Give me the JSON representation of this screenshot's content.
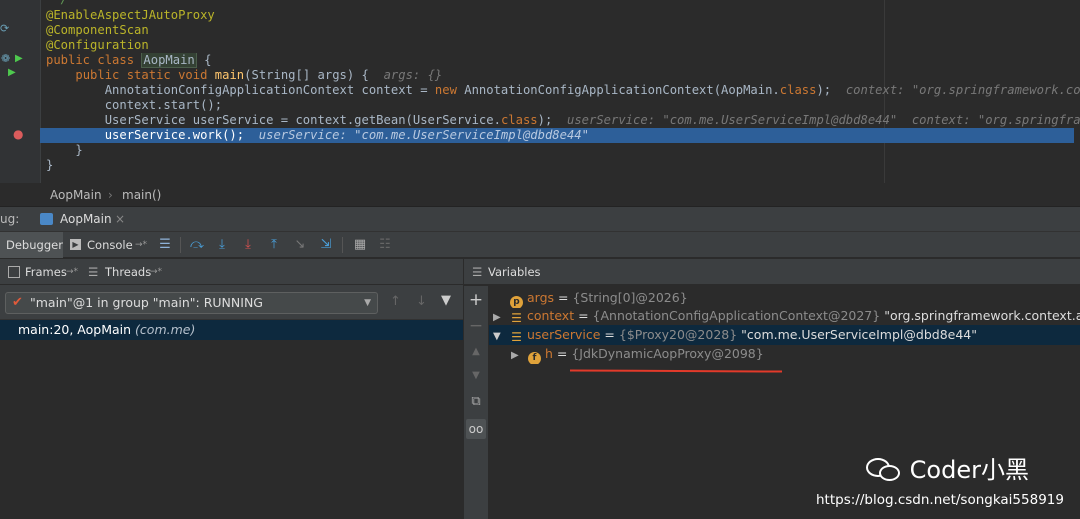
{
  "editor": {
    "lines": [
      {
        "parts": [
          {
            "c": "cm",
            "t": " */"
          }
        ]
      },
      {
        "parts": [
          {
            "c": "ann",
            "t": "@EnableAspectJAutoProxy"
          }
        ]
      },
      {
        "parts": [
          {
            "c": "ann",
            "t": "@ComponentScan"
          }
        ]
      },
      {
        "parts": [
          {
            "c": "ann",
            "t": "@Configuration"
          }
        ]
      },
      {
        "parts": [
          {
            "c": "kw",
            "t": "public class "
          },
          {
            "c": "cls-hl",
            "t": "AopMain"
          },
          {
            "c": "",
            "t": " {"
          }
        ]
      },
      {
        "parts": [
          {
            "c": "",
            "t": "    "
          },
          {
            "c": "kw",
            "t": "public static void "
          },
          {
            "c": "fn",
            "t": "main"
          },
          {
            "c": "",
            "t": "(String[] args) {  "
          },
          {
            "c": "hint",
            "t": "args: {}"
          }
        ]
      },
      {
        "parts": [
          {
            "c": "",
            "t": "        AnnotationConfigApplicationContext context = "
          },
          {
            "c": "kw",
            "t": "new "
          },
          {
            "c": "",
            "t": "AnnotationConfigApplicationContext(AopMain."
          },
          {
            "c": "kw",
            "t": "class"
          },
          {
            "c": "",
            "t": ");  "
          },
          {
            "c": "hint",
            "t": "context: \"org.springframework.context.a"
          }
        ]
      },
      {
        "parts": [
          {
            "c": "",
            "t": "        context.start();"
          }
        ]
      },
      {
        "parts": [
          {
            "c": "",
            "t": "        UserService userService = context.getBean(UserService."
          },
          {
            "c": "kw",
            "t": "class"
          },
          {
            "c": "",
            "t": ");  "
          },
          {
            "c": "hint",
            "t": "userService: \"com.me.UserServiceImpl@dbd8e44\"  context: \"org.springframework."
          }
        ]
      },
      {
        "parts": [
          {
            "c": "",
            "t": "        userService.work();  "
          },
          {
            "c": "hint",
            "t": "userService: \"com.me.UserServiceImpl@dbd8e44\""
          }
        ]
      },
      {
        "parts": [
          {
            "c": "",
            "t": "    }"
          }
        ]
      },
      {
        "parts": [
          {
            "c": "",
            "t": "}"
          }
        ]
      }
    ]
  },
  "breadcrumb": {
    "items": [
      "AopMain",
      "›",
      "main()"
    ]
  },
  "debug_tabs": {
    "label": "ug:",
    "session": "AopMain",
    "close": "×"
  },
  "toolbar": {
    "debugger_tab": "Debugger",
    "console_tab": "Console",
    "console_suffix": "→*"
  },
  "frames": {
    "header_frames": "Frames",
    "header_frames_suffix": "→*",
    "header_threads": "Threads",
    "header_threads_suffix": "→*",
    "thread_selected": "\"main\"@1 in group \"main\": RUNNING",
    "frame_method": "main:20, AopMain",
    "frame_pkg": "(com.me)"
  },
  "variables": {
    "header": "Variables",
    "rows": [
      {
        "name": "args",
        "eq": " = ",
        "type": "{String[0]@2026}",
        "value": ""
      },
      {
        "name": "context",
        "eq": " = ",
        "type": "{AnnotationConfigApplicationContext@2027}",
        "value": " \"org.springframework.context.an"
      },
      {
        "name": "userService",
        "eq": " = ",
        "type": "{$Proxy20@2028}",
        "value": " \"com.me.UserServiceImpl@dbd8e44\""
      },
      {
        "name": "h",
        "eq": " = ",
        "type": "{JdkDynamicAopProxy@2098}",
        "value": ""
      }
    ]
  },
  "watermark": {
    "brand": "Coder小黑",
    "url": "https://blog.csdn.net/songkai558919"
  },
  "colors": {
    "accent_underline": "#e23a2a",
    "selection": "#2d5f99",
    "keyword": "#cc7832"
  }
}
